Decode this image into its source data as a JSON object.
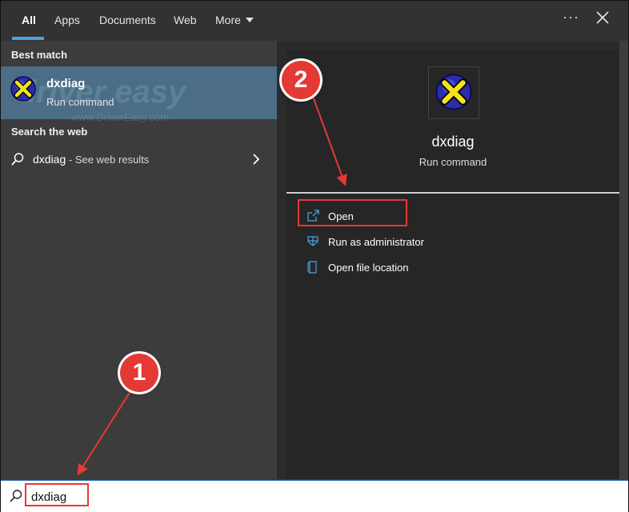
{
  "tabs": [
    {
      "label": "All",
      "active": true
    },
    {
      "label": "Apps"
    },
    {
      "label": "Documents"
    },
    {
      "label": "Web"
    },
    {
      "label": "More"
    }
  ],
  "left": {
    "best_match_label": "Best match",
    "best_item": {
      "name": "dxdiag",
      "type": "Run command",
      "icon": "directx-icon"
    },
    "watermark": {
      "main": "driver easy",
      "sub": "www.DriverEasy.com"
    },
    "search_web_label": "Search the web",
    "web_item": {
      "query": "dxdiag",
      "suffix": " - See web results"
    }
  },
  "right": {
    "name": "dxdiag",
    "type": "Run command",
    "actions": [
      {
        "label": "Open",
        "icon": "open-icon"
      },
      {
        "label": "Run as administrator",
        "icon": "shield-icon"
      },
      {
        "label": "Open file location",
        "icon": "file-location-icon"
      }
    ]
  },
  "search": {
    "value": "dxdiag"
  },
  "annotations": {
    "step1": "1",
    "step2": "2"
  },
  "colors": {
    "accent": "#4aa3df",
    "highlight": "#4b6d86",
    "annotation": "#e53935"
  }
}
